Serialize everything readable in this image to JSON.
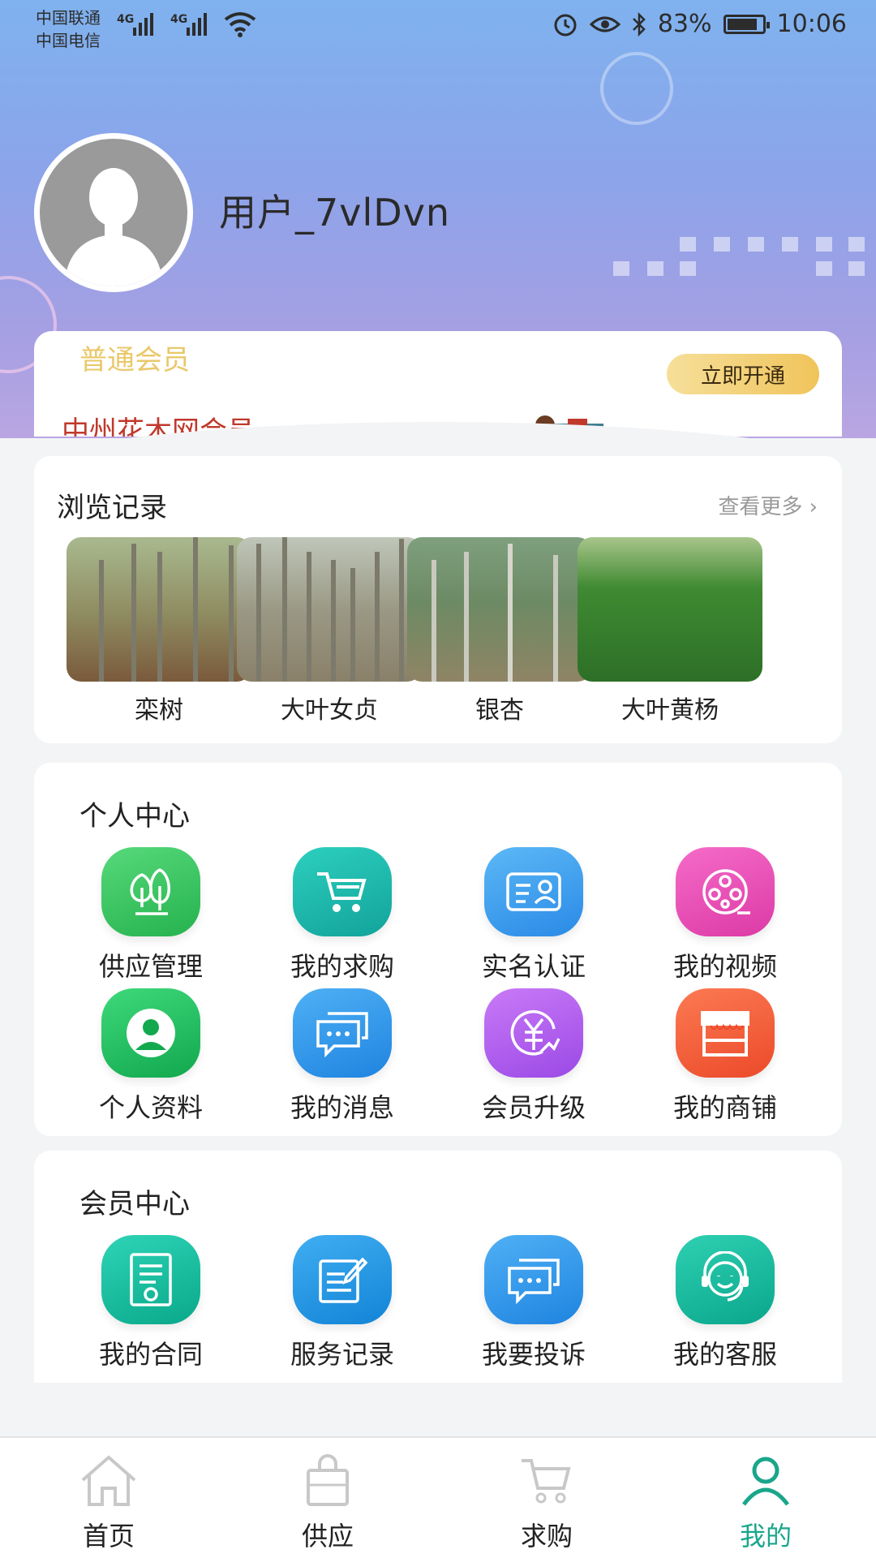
{
  "status_bar": {
    "carrier1": "中国联通",
    "carrier2": "中国电信",
    "network1": "4G",
    "network2": "4G",
    "battery": "83%",
    "time": "10:06"
  },
  "profile": {
    "username": "用户_7vlDvn"
  },
  "member_card": {
    "level": "普通会员",
    "open_button": "立即开通",
    "member_title": "中州花木网会员"
  },
  "history": {
    "title": "浏览记录",
    "more": "查看更多",
    "items": [
      {
        "name": "栾树"
      },
      {
        "name": "大叶女贞"
      },
      {
        "name": "银杏"
      },
      {
        "name": "大叶黄杨"
      }
    ]
  },
  "personal_center": {
    "title": "个人中心",
    "items": [
      {
        "label": "供应管理",
        "icon": "tree-icon",
        "color": "#35c86a"
      },
      {
        "label": "我的求购",
        "icon": "cart-icon",
        "color": "#1eb5a8"
      },
      {
        "label": "实名认证",
        "icon": "id-card-icon",
        "color": "#3d9df0"
      },
      {
        "label": "我的视频",
        "icon": "film-reel-icon",
        "color": "#ee4fb6"
      },
      {
        "label": "个人资料",
        "icon": "user-profile-icon",
        "color": "#1fbf6a"
      },
      {
        "label": "我的消息",
        "icon": "message-icon",
        "color": "#2e8be8"
      },
      {
        "label": "会员升级",
        "icon": "yuan-upgrade-icon",
        "color": "#b85cf0"
      },
      {
        "label": "我的商铺",
        "icon": "store-icon",
        "color": "#f4603b"
      }
    ]
  },
  "vip_center": {
    "title": "会员中心",
    "items": [
      {
        "label": "我的合同",
        "icon": "contract-icon",
        "color": "#17bfa0"
      },
      {
        "label": "服务记录",
        "icon": "edit-record-icon",
        "color": "#2196e0"
      },
      {
        "label": "我要投诉",
        "icon": "complaint-icon",
        "color": "#2e8be8"
      },
      {
        "label": "我的客服",
        "icon": "headset-icon",
        "color": "#19b8a0"
      }
    ]
  },
  "bottom_nav": {
    "items": [
      {
        "label": "首页",
        "icon": "home-icon"
      },
      {
        "label": "供应",
        "icon": "bag-icon"
      },
      {
        "label": "求购",
        "icon": "cart-icon"
      },
      {
        "label": "我的",
        "icon": "person-icon"
      }
    ],
    "active_color": "#1aa68a"
  }
}
